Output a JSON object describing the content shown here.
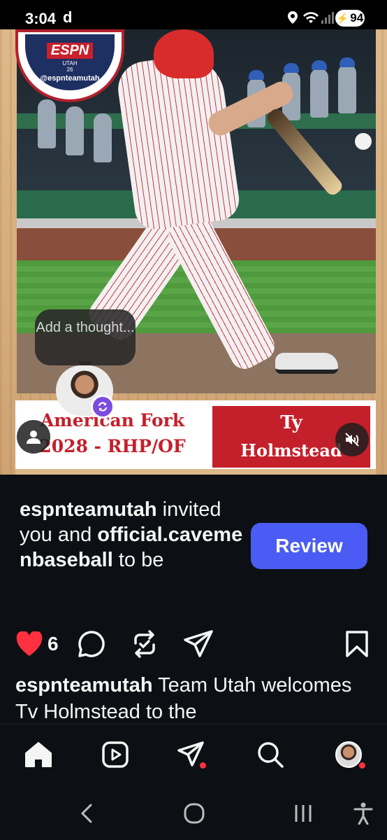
{
  "status_bar": {
    "time": "3:04",
    "carrier_glyph": "d",
    "battery": "94",
    "icons": [
      "location-icon",
      "wifi-icon",
      "signal-icon",
      "battery-icon"
    ]
  },
  "post": {
    "logo": {
      "brand": "ESPN",
      "region": "UTAH",
      "year": "26",
      "handle": "@espnteamutah"
    },
    "banner": {
      "school": "American Fork",
      "class_position": "2028 - RHP/OF",
      "first_name": "Ty",
      "last_name": "Holmstead"
    },
    "thought_bubble": "Add a thought...",
    "collab_badge_icon": "repost-icon",
    "user_tag_icon": "person-icon",
    "mute_icon": "speaker-muted-icon"
  },
  "invite": {
    "user": "espnteamutah",
    "text_1": " invited you and ",
    "user_2": "official.cavemenbaseball",
    "text_2": " to be",
    "review_label": "Review"
  },
  "actions": {
    "like_count": "6",
    "like_color": "#ff3040",
    "icons": [
      "heart-icon",
      "comment-icon",
      "repost-icon",
      "share-icon",
      "bookmark-icon"
    ]
  },
  "caption": {
    "user": "espnteamutah",
    "text": " Team Utah welcomes Tv Holmstead to the"
  },
  "bottom_nav": {
    "items": [
      "home-icon",
      "reels-icon",
      "messages-icon",
      "search-icon",
      "profile-avatar"
    ]
  },
  "system_nav": [
    "back-icon",
    "home-circle-icon",
    "recents-icon",
    "accessibility-icon"
  ],
  "colors": {
    "review_button": "#4a5cf3",
    "banner_red": "#c4202b",
    "background": "#0c1014"
  }
}
